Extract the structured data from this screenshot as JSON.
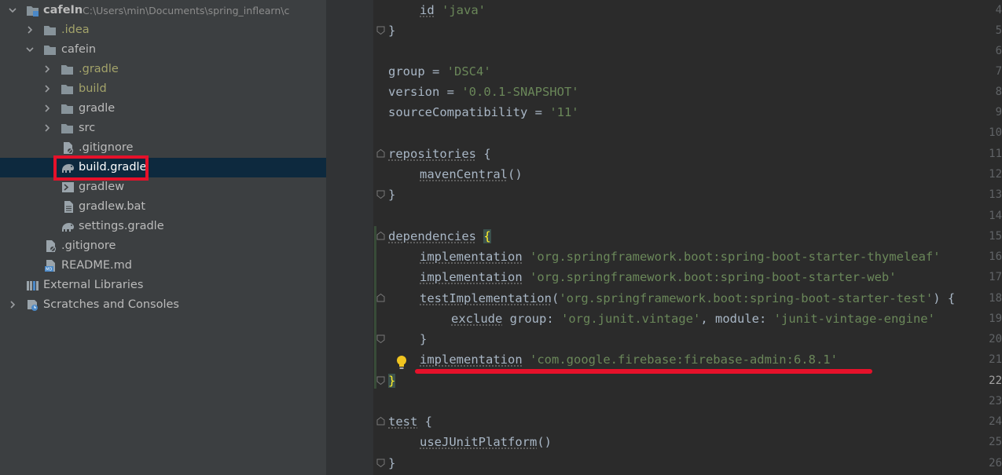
{
  "tree": {
    "root": {
      "name": "cafeIn",
      "path": "C:\\Users\\min\\Documents\\spring_inflearn\\c"
    },
    "items": [
      {
        "label": ".idea",
        "icon": "folder-icon",
        "style": "olive"
      },
      {
        "label": "cafein",
        "icon": "folder-icon",
        "style": "normal"
      },
      {
        "label": ".gradle",
        "icon": "folder-icon",
        "style": "olive"
      },
      {
        "label": "build",
        "icon": "folder-icon",
        "style": "olive"
      },
      {
        "label": "gradle",
        "icon": "folder-icon",
        "style": "normal"
      },
      {
        "label": "src",
        "icon": "folder-icon",
        "style": "normal"
      },
      {
        "label": ".gitignore",
        "icon": "gitignore-file-icon",
        "style": "normal"
      },
      {
        "label": "build.gradle",
        "icon": "gradle-elephant-icon",
        "style": "selected"
      },
      {
        "label": "gradlew",
        "icon": "terminal-script-icon",
        "style": "normal"
      },
      {
        "label": "gradlew.bat",
        "icon": "text-file-icon",
        "style": "normal"
      },
      {
        "label": "settings.gradle",
        "icon": "gradle-elephant-icon",
        "style": "normal"
      },
      {
        "label": ".gitignore",
        "icon": "gitignore-file-icon",
        "style": "normal"
      },
      {
        "label": "README.md",
        "icon": "markdown-file-icon",
        "style": "normal"
      },
      {
        "label": "External Libraries",
        "icon": "libraries-icon",
        "style": "normal"
      },
      {
        "label": "Scratches and Consoles",
        "icon": "scratches-icon",
        "style": "normal"
      }
    ]
  },
  "editor": {
    "current_line": 22,
    "lines": [
      {
        "n": "4",
        "text": "id 'java'"
      },
      {
        "n": "5",
        "text": "}"
      },
      {
        "n": "6",
        "text": ""
      },
      {
        "n": "7",
        "text": "group = 'DSC4'"
      },
      {
        "n": "8",
        "text": "version = '0.0.1-SNAPSHOT'"
      },
      {
        "n": "9",
        "text": "sourceCompatibility = '11'"
      },
      {
        "n": "10",
        "text": ""
      },
      {
        "n": "11",
        "text": "repositories {"
      },
      {
        "n": "12",
        "text": "mavenCentral()"
      },
      {
        "n": "13",
        "text": "}"
      },
      {
        "n": "14",
        "text": ""
      },
      {
        "n": "15",
        "text": "dependencies {"
      },
      {
        "n": "16",
        "text": "implementation 'org.springframework.boot:spring-boot-starter-thymeleaf'"
      },
      {
        "n": "17",
        "text": "implementation 'org.springframework.boot:spring-boot-starter-web'"
      },
      {
        "n": "18",
        "text": "testImplementation('org.springframework.boot:spring-boot-starter-test') {"
      },
      {
        "n": "19",
        "text": "exclude group: 'org.junit.vintage', module: 'junit-vintage-engine'"
      },
      {
        "n": "20",
        "text": "}"
      },
      {
        "n": "21",
        "text": "implementation 'com.google.firebase:firebase-admin:6.8.1'"
      },
      {
        "n": "22",
        "text": "}"
      },
      {
        "n": "23",
        "text": ""
      },
      {
        "n": "24",
        "text": "test {"
      },
      {
        "n": "25",
        "text": "useJUnitPlatform()"
      },
      {
        "n": "26",
        "text": "}"
      }
    ]
  },
  "colors": {
    "tree_bg": "#3c3f41",
    "editor_bg": "#2b2b2b",
    "gutter_bg": "#313335",
    "selection": "#0d293e",
    "annotation_red": "#e5112a",
    "string_green": "#6a8759",
    "excluded_folder_olive": "#a3a36a"
  }
}
